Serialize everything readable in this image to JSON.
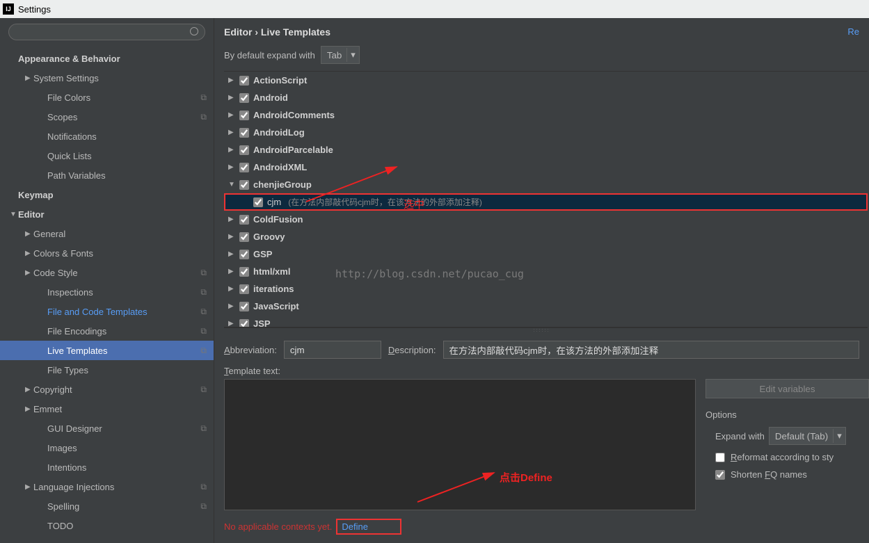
{
  "window": {
    "title": "Settings"
  },
  "breadcrumb": {
    "path": "Editor › Live Templates",
    "reset": "Re"
  },
  "sidebar": {
    "items": [
      {
        "label": "Appearance & Behavior",
        "header": true,
        "arrow": ""
      },
      {
        "label": "System Settings",
        "depth": 1,
        "arrow": "▶"
      },
      {
        "label": "File Colors",
        "depth": 2,
        "copy": true
      },
      {
        "label": "Scopes",
        "depth": 2,
        "copy": true
      },
      {
        "label": "Notifications",
        "depth": 2
      },
      {
        "label": "Quick Lists",
        "depth": 2
      },
      {
        "label": "Path Variables",
        "depth": 2
      },
      {
        "label": "Keymap",
        "header": true
      },
      {
        "label": "Editor",
        "header": true,
        "arrow": "▼"
      },
      {
        "label": "General",
        "depth": 1,
        "arrow": "▶"
      },
      {
        "label": "Colors & Fonts",
        "depth": 1,
        "arrow": "▶"
      },
      {
        "label": "Code Style",
        "depth": 1,
        "arrow": "▶",
        "copy": true
      },
      {
        "label": "Inspections",
        "depth": 2,
        "copy": true
      },
      {
        "label": "File and Code Templates",
        "depth": 2,
        "copy": true,
        "active": true
      },
      {
        "label": "File Encodings",
        "depth": 2,
        "copy": true
      },
      {
        "label": "Live Templates",
        "depth": 2,
        "copy": true,
        "selected": true
      },
      {
        "label": "File Types",
        "depth": 2
      },
      {
        "label": "Copyright",
        "depth": 1,
        "arrow": "▶",
        "copy": true
      },
      {
        "label": "Emmet",
        "depth": 1,
        "arrow": "▶"
      },
      {
        "label": "GUI Designer",
        "depth": 2,
        "copy": true
      },
      {
        "label": "Images",
        "depth": 2
      },
      {
        "label": "Intentions",
        "depth": 2
      },
      {
        "label": "Language Injections",
        "depth": 1,
        "arrow": "▶",
        "copy": true
      },
      {
        "label": "Spelling",
        "depth": 2,
        "copy": true
      },
      {
        "label": "TODO",
        "depth": 2
      }
    ]
  },
  "expand": {
    "label": "By default expand with",
    "value": "Tab"
  },
  "templates": [
    {
      "name": "ActionScript",
      "arrow": "▶"
    },
    {
      "name": "Android",
      "arrow": "▶"
    },
    {
      "name": "AndroidComments",
      "arrow": "▶"
    },
    {
      "name": "AndroidLog",
      "arrow": "▶"
    },
    {
      "name": "AndroidParcelable",
      "arrow": "▶"
    },
    {
      "name": "AndroidXML",
      "arrow": "▶"
    },
    {
      "name": "chenjieGroup",
      "arrow": "▼",
      "expanded": true
    },
    {
      "name": "cjm",
      "child": true,
      "desc": "(在方法内部敲代码cjm时，在该方法的外部添加注释)",
      "selected": true
    },
    {
      "name": "ColdFusion",
      "arrow": "▶"
    },
    {
      "name": "Groovy",
      "arrow": "▶"
    },
    {
      "name": "GSP",
      "arrow": "▶"
    },
    {
      "name": "html/xml",
      "arrow": "▶"
    },
    {
      "name": "iterations",
      "arrow": "▶"
    },
    {
      "name": "JavaScript",
      "arrow": "▶"
    },
    {
      "name": "JSP",
      "arrow": "▶"
    }
  ],
  "form": {
    "abbr_label": "Abbreviation:",
    "abbr_value": "cjm",
    "desc_label": "Description:",
    "desc_value": "在方法内部敲代码cjm时，在该方法的外部添加注释",
    "template_text_label": "Template text:"
  },
  "no_context": {
    "text": "No applicable contexts yet.",
    "link": "Define"
  },
  "options": {
    "edit_vars": "Edit variables",
    "title": "Options",
    "expand_label": "Expand with",
    "expand_value": "Default (Tab)",
    "reformat": "Reformat according to sty",
    "shorten": "Shorten FQ names"
  },
  "annotations": {
    "select": "选中",
    "click_define": "点击Define",
    "watermark": "http://blog.csdn.net/pucao_cug"
  }
}
